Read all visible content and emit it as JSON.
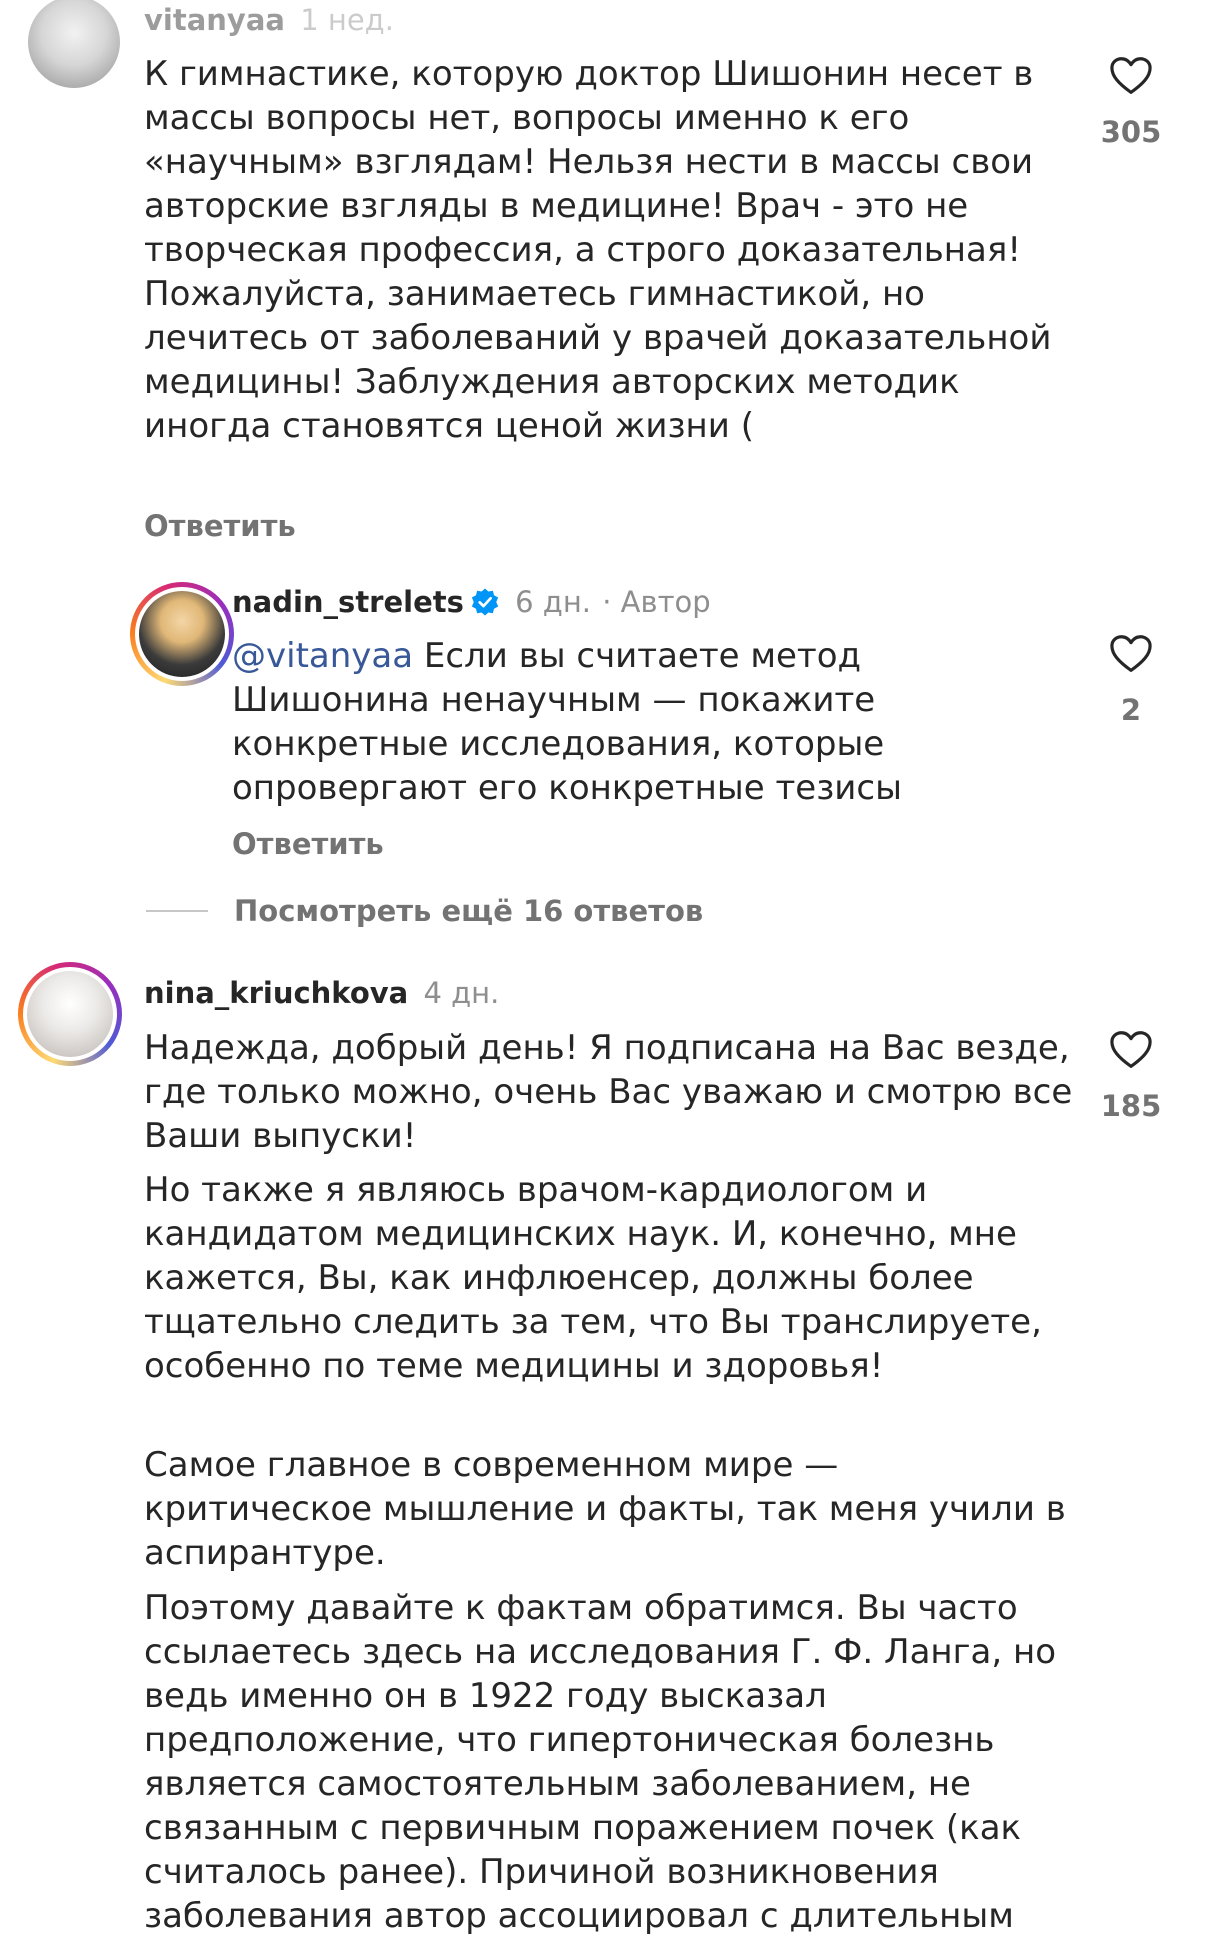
{
  "comments": [
    {
      "username": "vitanyaa",
      "time": "1 нед.",
      "text": "К гимнастике, которую доктор Шишонин несет в массы вопросы нет, вопросы именно к его «научным» взглядам! Нельзя нести в массы свои авторские взгляды в медицине! Врач - это не творческая профессия, а строго доказательная! Пожалуйста, занимаетесь гимнастикой, но лечитесь от заболеваний у врачей доказательной медицины! Заблуждения авторских методик иногда становятся ценой жизни (",
      "reply_label": "Ответить",
      "likes": "305"
    },
    {
      "username": "nadin_strelets",
      "time": "6 дн.",
      "author_tag": "· Автор",
      "mention": "@vitanyaa",
      "text": " Если вы считаете метод Шишонина ненаучным — покажите конкретные исследования, которые опровергают его конкретные тезисы",
      "reply_label": "Ответить",
      "likes": "2"
    },
    {
      "username": "nina_kriuchkova",
      "time": "4 дн.",
      "paragraphs": [
        "Надежда, добрый день! Я подписана на Вас везде, где только можно, очень Вас уважаю и смотрю все Ваши выпуски!",
        "Но также я являюсь врачом-кардиологом и кандидатом медицинских наук. И, конечно, мне кажется, Вы, как инфлюенсер, должны более тщательно следить за тем, что Вы транслируете, особенно по теме медицины и здоровья!",
        "Самое главное в современном мире — критическое мышление и факты, так меня учили в аспирантуре.",
        "Поэтому давайте к фактам обратимся. Вы часто ссылаетесь здесь на исследования Г. Ф. Ланга, но ведь именно он в 1922 году высказал предположение, что гипертоническая болезнь является самостоятельным заболеванием, не связанным с первичным поражением почек (как считалось ранее). Причиной возникновения заболевания автор ассоциировал с длительным"
      ],
      "likes": "185"
    }
  ],
  "view_more_replies": "Посмотреть ещё 16 ответов",
  "icons": {
    "heart": "heart-outline-icon",
    "verified": "verified-badge-icon"
  },
  "colors": {
    "text": "#262626",
    "secondary": "#737373",
    "mention": "#385898",
    "verified": "#0095f6"
  }
}
